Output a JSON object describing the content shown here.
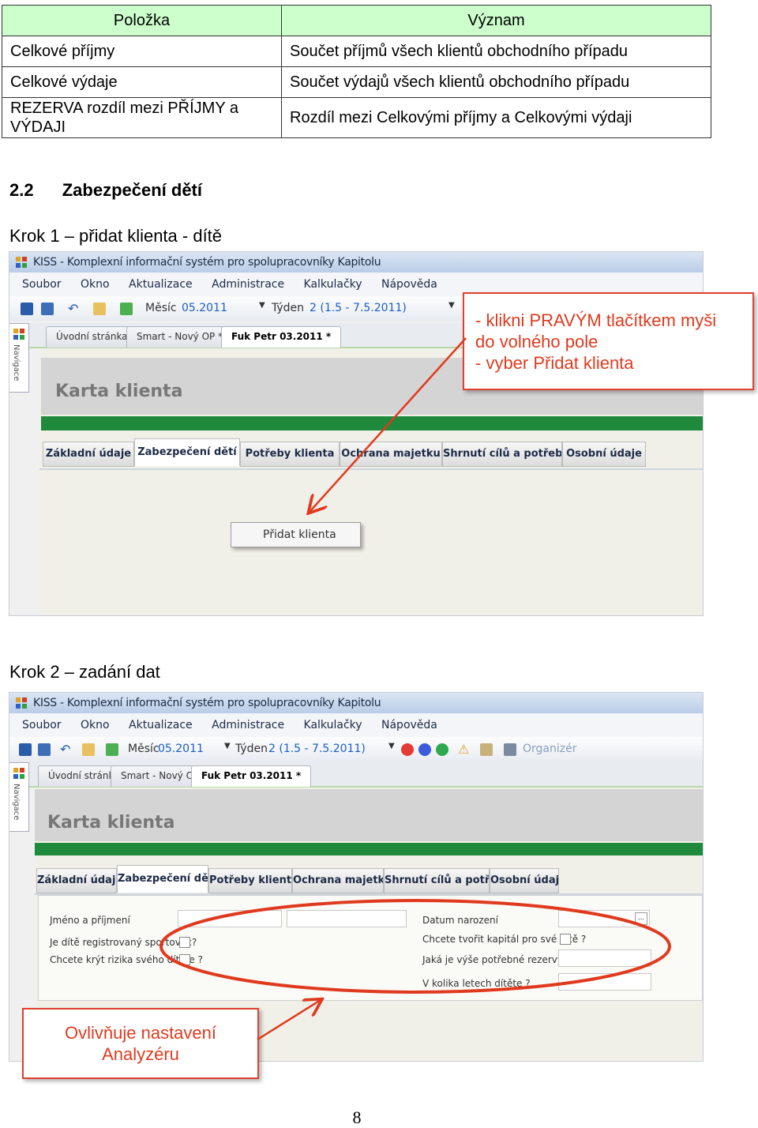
{
  "table": {
    "headers": [
      "Položka",
      "Význam"
    ],
    "rows": [
      [
        "Celkové příjmy",
        "Součet příjmů všech klientů obchodního případu"
      ],
      [
        "Celkové výdaje",
        "Součet výdajů všech klientů obchodního případu"
      ],
      [
        "REZERVA rozdíl mezi PŘÍJMY a VÝDAJI",
        "Rozdíl mezi Celkovými příjmy a Celkovými výdaji"
      ]
    ]
  },
  "section": {
    "number": "2.2",
    "title": "Zabezpečení dětí"
  },
  "step1": {
    "label": "Krok 1 – přidat klienta - dítě",
    "app": {
      "title": "KISS - Komplexní informační systém pro spolupracovníky Kapitolu",
      "menu": [
        "Soubor",
        "Okno",
        "Aktualizace",
        "Administrace",
        "Kalkulačky",
        "Nápověda"
      ],
      "toolbar": {
        "month_label": "Měsíc",
        "month_value": "05.2011",
        "week_label": "Týden",
        "week_value": "2 (1.5 - 7.5.2011)"
      },
      "doc_tabs": [
        "Úvodní stránka",
        "Smart - Nový OP *",
        "Fuk Petr 03.2011 *"
      ],
      "sidebar_label": "Navigace",
      "karta_title": "Karta klienta",
      "sub_tabs": [
        "Základní údaje",
        "Zabezpečení dětí",
        "Potřeby klienta",
        "Ochrana majetku",
        "Shrnutí cílů a potřeb",
        "Osobní údaje"
      ],
      "context_item": "Přidat klienta"
    },
    "callout": [
      "- klikni PRAVÝM tlačítkem myši",
      "do volného pole",
      "- vyber Přidat klienta"
    ]
  },
  "step2": {
    "label": "Krok 2 – zadání dat",
    "app": {
      "title": "KISS - Komplexní informační systém pro spolupracovníky Kapitolu",
      "menu": [
        "Soubor",
        "Okno",
        "Aktualizace",
        "Administrace",
        "Kalkulačky",
        "Nápověda"
      ],
      "toolbar": {
        "month_label": "Měsíc",
        "month_value": "05.2011",
        "week_label": "Týden",
        "week_value": "2 (1.5 - 7.5.2011)",
        "organizer": "Organizér"
      },
      "doc_tabs": [
        "Úvodní stránka",
        "Smart - Nový OP *",
        "Fuk Petr 03.2011 *"
      ],
      "sidebar_label": "Navigace",
      "karta_title": "Karta klienta",
      "sub_tabs": [
        "Základní údaje",
        "Zabezpečení dětí",
        "Potřeby klienta",
        "Ochrana majetku",
        "Shrnutí cílů a potřeb",
        "Osobní údaje"
      ],
      "form": {
        "name_label": "Jméno a příjmení",
        "sport_label": "Je dítě registrovaný sportovec?",
        "risk_label": "Chcete krýt rizika svého dítěte ?",
        "birth_label": "Datum narození",
        "capital_label": "Chcete tvořit kapitál pro své dítě ?",
        "reserve_label": "Jaká je výše potřebné rezervy ?",
        "age_label": "V kolika letech dítěte ?"
      }
    },
    "callout": [
      "Ovlivňuje nastavení",
      "Analyzéru"
    ]
  },
  "page_number": "8",
  "colors": {
    "callout_red": "#e03a1e",
    "header_green": "#ccffcc",
    "app_green": "#1f8a3c"
  }
}
